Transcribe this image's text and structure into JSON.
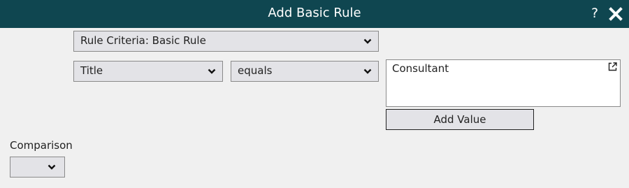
{
  "dialog": {
    "title": "Add Basic Rule",
    "help_label": "?",
    "icons": {
      "close": "close-icon",
      "help": "help-icon",
      "external": "external-link-icon",
      "chevron": "chevron-down-icon"
    },
    "colors": {
      "titlebar": "#0f4650",
      "field_bg": "#e3e3e7",
      "body_bg": "#f0f0f0"
    }
  },
  "rule": {
    "criteria_selected": "Rule Criteria: Basic Rule",
    "field_selected": "Title",
    "operator_selected": "equals",
    "value_text": "Consultant",
    "add_value_label": "Add Value"
  },
  "comparison": {
    "label": "Comparison",
    "selected": ""
  }
}
